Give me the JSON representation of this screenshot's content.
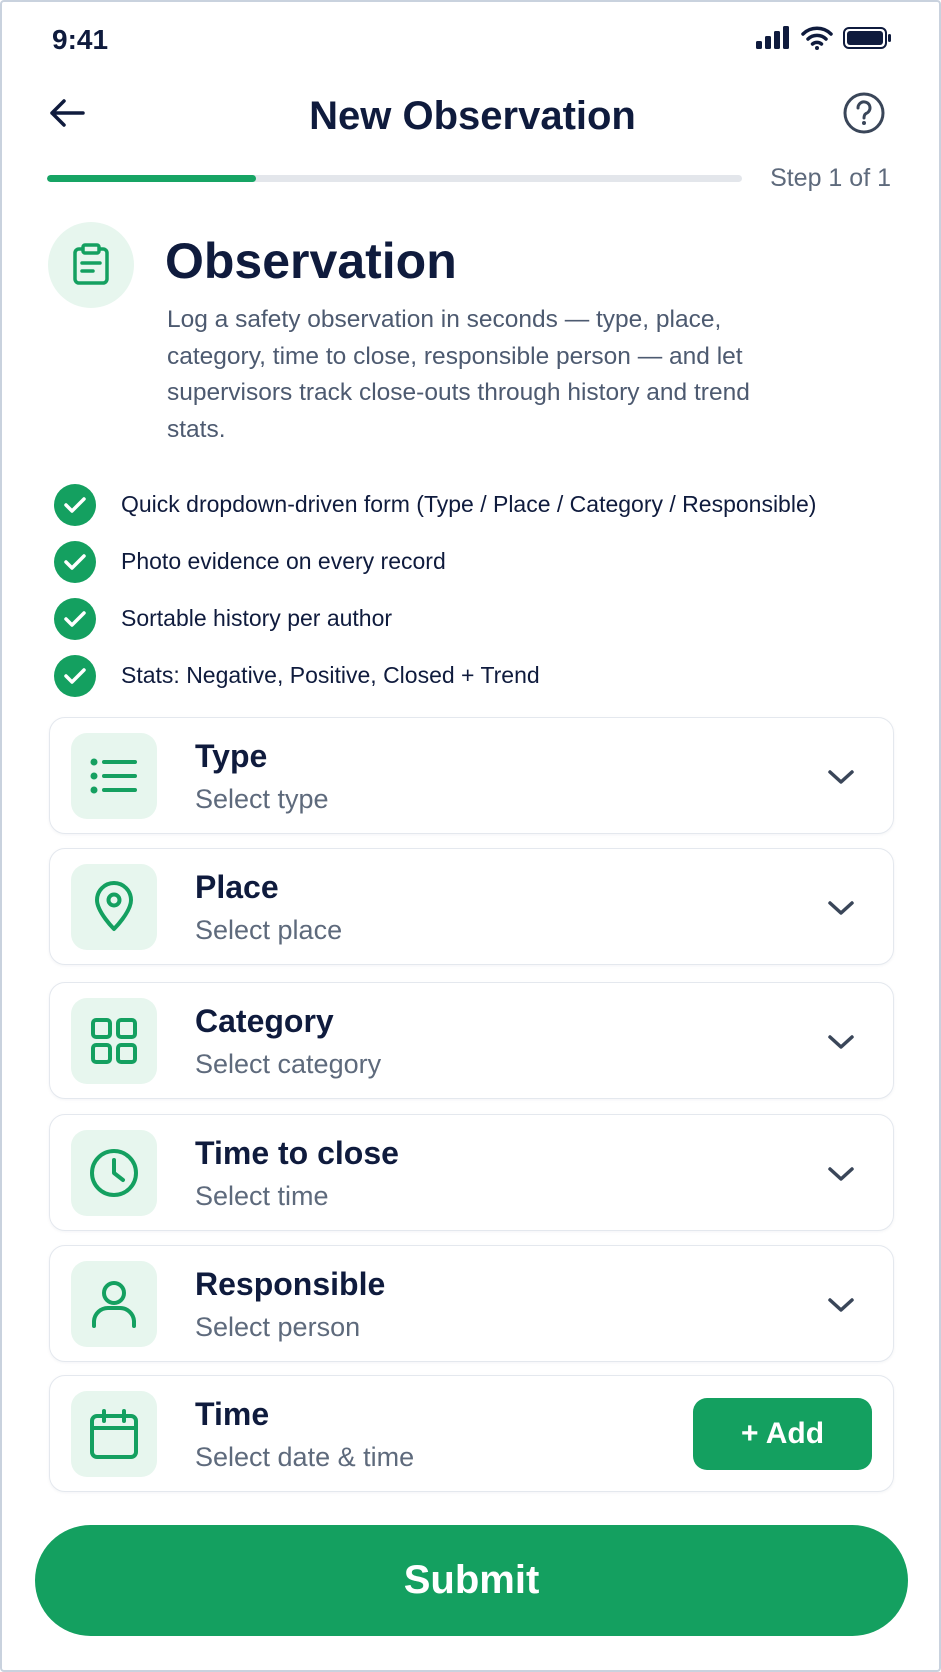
{
  "status_bar": {
    "time": "9:41"
  },
  "header": {
    "title": "New Observation"
  },
  "progress": {
    "fraction": 0.3,
    "step_label": "Step 1 of 1"
  },
  "intro": {
    "title": "Observation",
    "description": "Log a safety observation in seconds — type, place, category, time to close, responsible person — and let supervisors track close-outs through history and trend stats."
  },
  "features": [
    "Quick dropdown-driven form (Type / Place / Category / Responsible)",
    "Photo evidence on every record",
    "Sortable history per author",
    "Stats: Negative, Positive, Closed + Trend"
  ],
  "fields": [
    {
      "label": "Type",
      "placeholder": "Select type",
      "icon": "list-icon"
    },
    {
      "label": "Place",
      "placeholder": "Select place",
      "icon": "map-pin-icon"
    },
    {
      "label": "Category",
      "placeholder": "Select category",
      "icon": "grid-icon"
    },
    {
      "label": "Time to close",
      "placeholder": "Select time",
      "icon": "clock-icon"
    },
    {
      "label": "Responsible",
      "placeholder": "Select person",
      "icon": "person-icon"
    },
    {
      "label": "Time",
      "placeholder": "Select date & time",
      "icon": "calendar-icon",
      "action": "+ Add"
    }
  ],
  "submit_label": "Submit",
  "colors": {
    "accent": "#14a060",
    "accent_light": "#e7f6ee",
    "text": "#0f1b3d",
    "muted": "#5e6a7c"
  }
}
